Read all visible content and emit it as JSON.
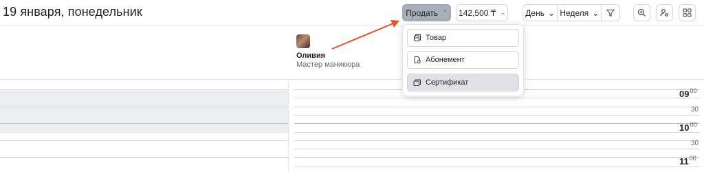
{
  "header": {
    "date_title": "19 января, понедельник",
    "sell_button": "Продать",
    "price_button": "142,500 ₸",
    "view_day": "День",
    "view_week": "Неделя"
  },
  "staff": {
    "name": "Оливия",
    "role": "Мастер маникюра"
  },
  "sell_menu": {
    "items": [
      {
        "label": "Товар",
        "icon": "box-icon"
      },
      {
        "label": "Абонемент",
        "icon": "subscription-icon"
      },
      {
        "label": "Сертификат",
        "icon": "certificate-icon",
        "active": true
      }
    ]
  },
  "timeline": {
    "rows": [
      {
        "hour": "09",
        "minutes": "00"
      },
      {
        "half": "30"
      },
      {
        "hour": "10",
        "minutes": "00"
      },
      {
        "half": "30"
      },
      {
        "hour": "11",
        "minutes": "00"
      }
    ]
  },
  "colors": {
    "sell_button_bg": "#a9afb9",
    "arrow": "#e8512a",
    "active_item_bg": "#dfe1e6"
  }
}
